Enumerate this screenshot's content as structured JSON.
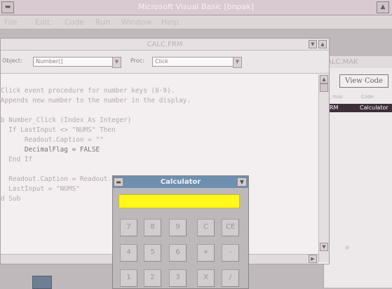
{
  "main_window": {
    "title": "Microsoft Visual Basic [bnpak]"
  },
  "menubar": {
    "items": [
      "File",
      "Edit",
      "Code",
      "Run",
      "Window",
      "Help"
    ]
  },
  "code_window": {
    "title": "CALC.FRM",
    "object_label": "Object:",
    "object_value": "Number(]",
    "proc_label": "Proc:",
    "proc_value": "Click",
    "lines": [
      "Click event procedure for number keys (0-9).",
      "Appends new number to the number in the display.",
      "",
      "b Number_Click (Index As Integer)",
      "  If LastInput <> \"NUMS\" Then",
      "      Readout.Caption = \"\"",
      "      DecimalFlag = FALSE",
      "  End If",
      "",
      "  Readout.Caption = Readout.Caption + Number(Index).Caption",
      "  LastInput = \"NUMS\"",
      "d Sub"
    ]
  },
  "project_window": {
    "title": "ALC.MAK",
    "view_code_label": "View Code",
    "column_labels": [
      "mas",
      "Code"
    ],
    "item_file": "RM",
    "item_name": "Calculator"
  },
  "calculator": {
    "title": "Calculator",
    "keys": [
      [
        "7",
        "8",
        "9",
        "C",
        "CE"
      ],
      [
        "4",
        "5",
        "6",
        "+",
        "-"
      ],
      [
        "1",
        "2",
        "3",
        "X",
        "/"
      ]
    ]
  },
  "colors": {
    "calc_title_bar": "#6f8fb0",
    "readout": "#fff81a",
    "selected_row": "#3d2e38"
  }
}
